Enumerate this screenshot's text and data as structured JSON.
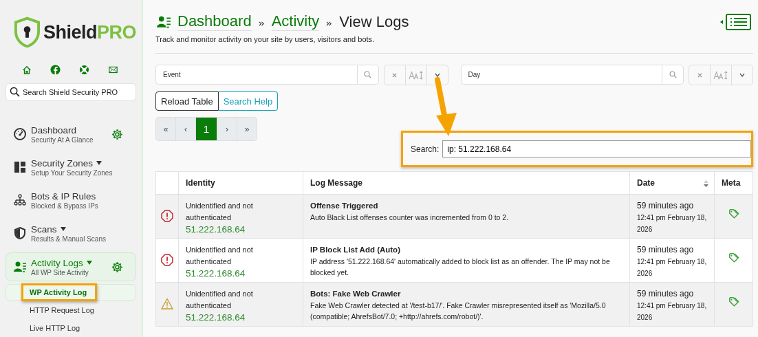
{
  "sidebar": {
    "logo": {
      "word": "Shield",
      "accent": "PRO"
    },
    "search": {
      "placeholder": "Search Shield Security PRO"
    },
    "nav": [
      {
        "title": "Dashboard",
        "subtitle": "Security At A Glance",
        "dropdown": false,
        "settings": true,
        "selected": false
      },
      {
        "title": "Security Zones",
        "subtitle": "Setup Your Security Zones",
        "dropdown": true,
        "settings": false,
        "selected": false
      },
      {
        "title": "Bots & IP Rules",
        "subtitle": "Blocked & Bypass IPs",
        "dropdown": false,
        "settings": false,
        "selected": false
      },
      {
        "title": "Scans",
        "subtitle": "Results & Manual Scans",
        "dropdown": true,
        "settings": false,
        "selected": false
      },
      {
        "title": "Activity Logs",
        "subtitle": "All WP Site Activity",
        "dropdown": true,
        "settings": true,
        "selected": true
      }
    ],
    "subnav": [
      {
        "label": "WP Activity Log",
        "selected": true
      },
      {
        "label": "HTTP Request Log",
        "selected": false
      },
      {
        "label": "Live HTTP Log",
        "selected": false
      }
    ]
  },
  "header": {
    "breadcrumbs": [
      "Dashboard",
      "Activity",
      "View Logs"
    ],
    "description": "Track and monitor activity on your site by users, visitors and bots."
  },
  "filters": [
    {
      "placeholder": "Event"
    },
    {
      "placeholder": "Day"
    }
  ],
  "buttons": [
    "Reload Table",
    "Search Help"
  ],
  "pagination": [
    {
      "label": "«",
      "selected": false
    },
    {
      "label": "‹",
      "selected": false
    },
    {
      "label": "1",
      "selected": true
    },
    {
      "label": "›",
      "selected": false
    },
    {
      "label": "»",
      "selected": false
    }
  ],
  "search": {
    "label": "Search:",
    "value": "ip: 51.222.168.64"
  },
  "table": {
    "columns": [
      "",
      "Identity",
      "Log Message",
      "Date",
      "Meta"
    ],
    "rows": [
      {
        "kind": "error",
        "identity": "Unidentified and not authenticated",
        "ip": "51.222.168.64",
        "title": "Offense Triggered",
        "message": "Auto Black List offenses counter was incremented from 0 to 2.",
        "ago": "59 minutes ago",
        "date": "12:41 pm February 18, 2026"
      },
      {
        "kind": "error",
        "identity": "Unidentified and not authenticated",
        "ip": "51.222.168.64",
        "title": "IP Block List Add (Auto)",
        "message": "IP address '51.222.168.64' automatically added to block list as an offender. The IP may not be blocked yet.",
        "ago": "59 minutes ago",
        "date": "12:41 pm February 18, 2026"
      },
      {
        "kind": "warning",
        "identity": "Unidentified and not authenticated",
        "ip": "51.222.168.64",
        "title": "Bots: Fake Web Crawler",
        "message": "Fake Web Crawler detected at '/test-b17/'. Fake Crawler misrepresented itself as 'Mozilla/5.0 (compatible; AhrefsBot/7.0; +http://ahrefs.com/robot/)'.",
        "ago": "59 minutes ago",
        "date": "12:41 pm February 18, 2026"
      }
    ]
  }
}
